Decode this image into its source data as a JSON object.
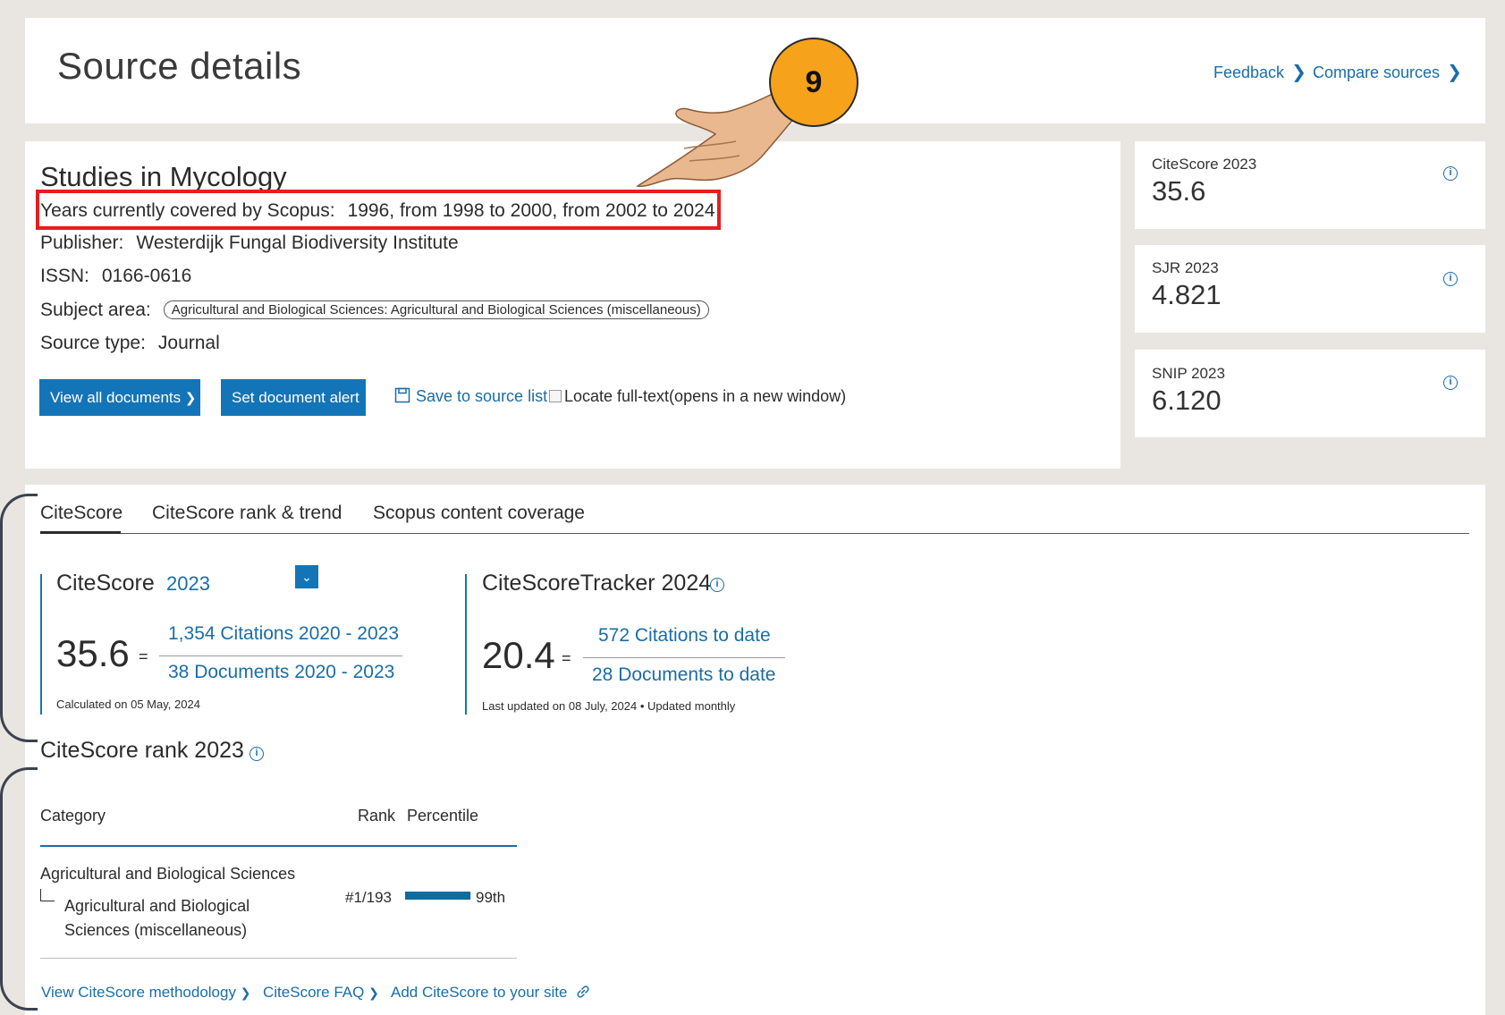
{
  "header": {
    "title": "Source details",
    "feedback": "Feedback",
    "compare": "Compare sources"
  },
  "source": {
    "title": "Studies in Mycology",
    "years_label": "Years currently covered by Scopus:",
    "years_value": "1996, from 1998 to 2000, from 2002 to 2024",
    "publisher_label": "Publisher:",
    "publisher_value": "Westerdijk Fungal Biodiversity Institute",
    "issn_label": "ISSN:",
    "issn_value": "0166-0616",
    "subject_label": "Subject area:",
    "subject_value": "Agricultural and Biological Sciences: Agricultural and Biological Sciences (miscellaneous)",
    "type_label": "Source type:",
    "type_value": "Journal"
  },
  "actions": {
    "view_all": "View all documents",
    "set_alert": "Set document alert",
    "save": "Save to source list",
    "locate": "Locate full-text(opens in a new window)"
  },
  "metrics": [
    {
      "label": "CiteScore 2023",
      "value": "35.6"
    },
    {
      "label": "SJR 2023",
      "value": "4.821"
    },
    {
      "label": "SNIP 2023",
      "value": "6.120"
    }
  ],
  "tabs": [
    "CiteScore",
    "CiteScore rank & trend",
    "Scopus content coverage"
  ],
  "citescore": {
    "label": "CiteScore",
    "year": "2023",
    "value": "35.6",
    "equals": "=",
    "citations": "1,354 Citations 2020 - 2023",
    "documents": "38 Documents 2020 - 2023",
    "note": "Calculated on 05 May, 2024"
  },
  "tracker": {
    "label": "CiteScoreTracker 2024",
    "value": "20.4",
    "equals": "=",
    "citations": "572 Citations to date",
    "documents": "28 Documents to date",
    "note": "Last updated on 08 July, 2024 • Updated monthly"
  },
  "rank": {
    "title": "CiteScore rank 2023",
    "headers": {
      "category": "Category",
      "rank": "Rank",
      "percentile": "Percentile"
    },
    "category_main": "Agricultural and Biological Sciences",
    "category_sub": "Agricultural and Biological Sciences (miscellaneous)",
    "rank_value": "#1/193",
    "percentile_value": "99th",
    "percentile_fraction": 0.99
  },
  "footer": {
    "methodology": "View CiteScore methodology",
    "faq": "CiteScore FAQ",
    "add": "Add CiteScore to your site"
  },
  "callout": {
    "step": "9"
  },
  "colors": {
    "accent": "#1474b8",
    "highlight": "#e61e1e",
    "callout": "#f7a21b",
    "percentile_bar": "#0e6c9e"
  }
}
